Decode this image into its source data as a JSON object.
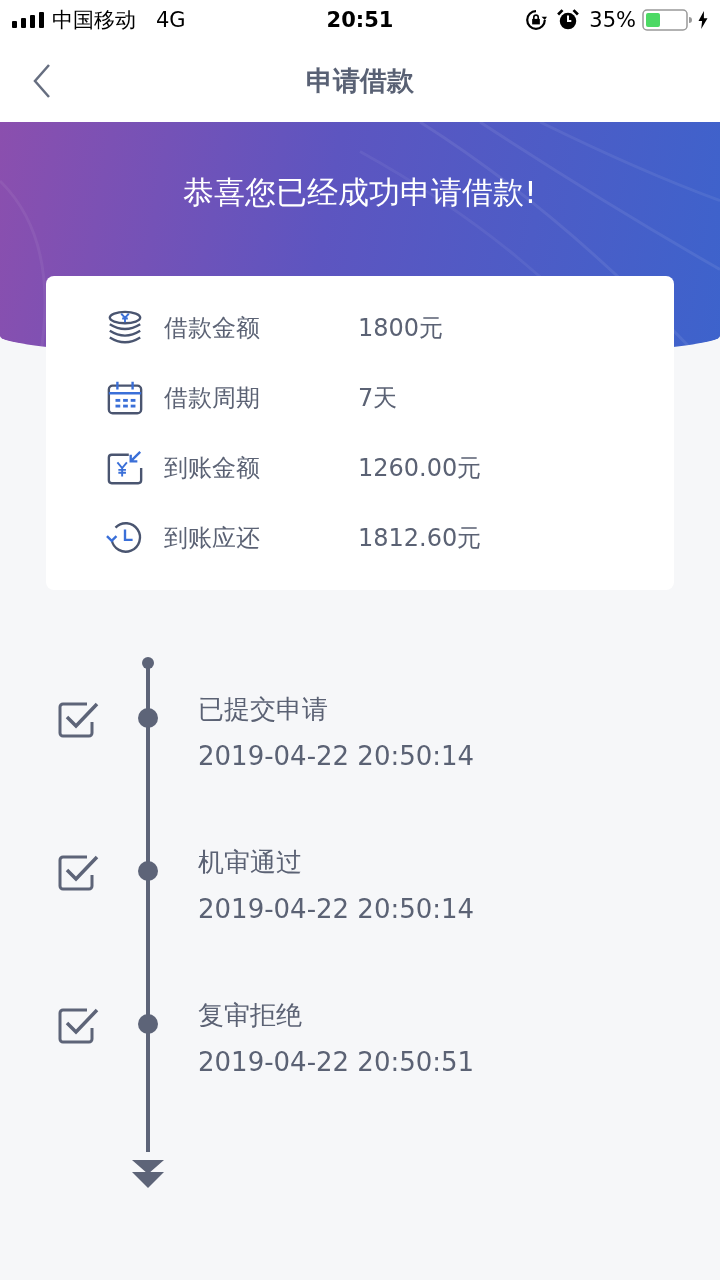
{
  "status_bar": {
    "carrier": "中国移动",
    "network": "4G",
    "time": "20:51",
    "battery": "35%"
  },
  "nav": {
    "title": "申请借款"
  },
  "banner": {
    "message": "恭喜您已经成功申请借款!"
  },
  "summary": [
    {
      "kind": "coins",
      "label": "借款金额",
      "value": "1800元"
    },
    {
      "kind": "calendar",
      "label": "借款周期",
      "value": "7天"
    },
    {
      "kind": "receive",
      "label": "到账金额",
      "value": "1260.00元"
    },
    {
      "kind": "repay",
      "label": "到账应还",
      "value": "1812.60元"
    }
  ],
  "timeline": [
    {
      "title": "已提交申请",
      "time": "2019-04-22 20:50:14",
      "checked": true
    },
    {
      "title": "机审通过",
      "time": "2019-04-22 20:50:14",
      "checked": true
    },
    {
      "title": "复审拒绝",
      "time": "2019-04-22 20:50:51",
      "checked": true
    }
  ]
}
